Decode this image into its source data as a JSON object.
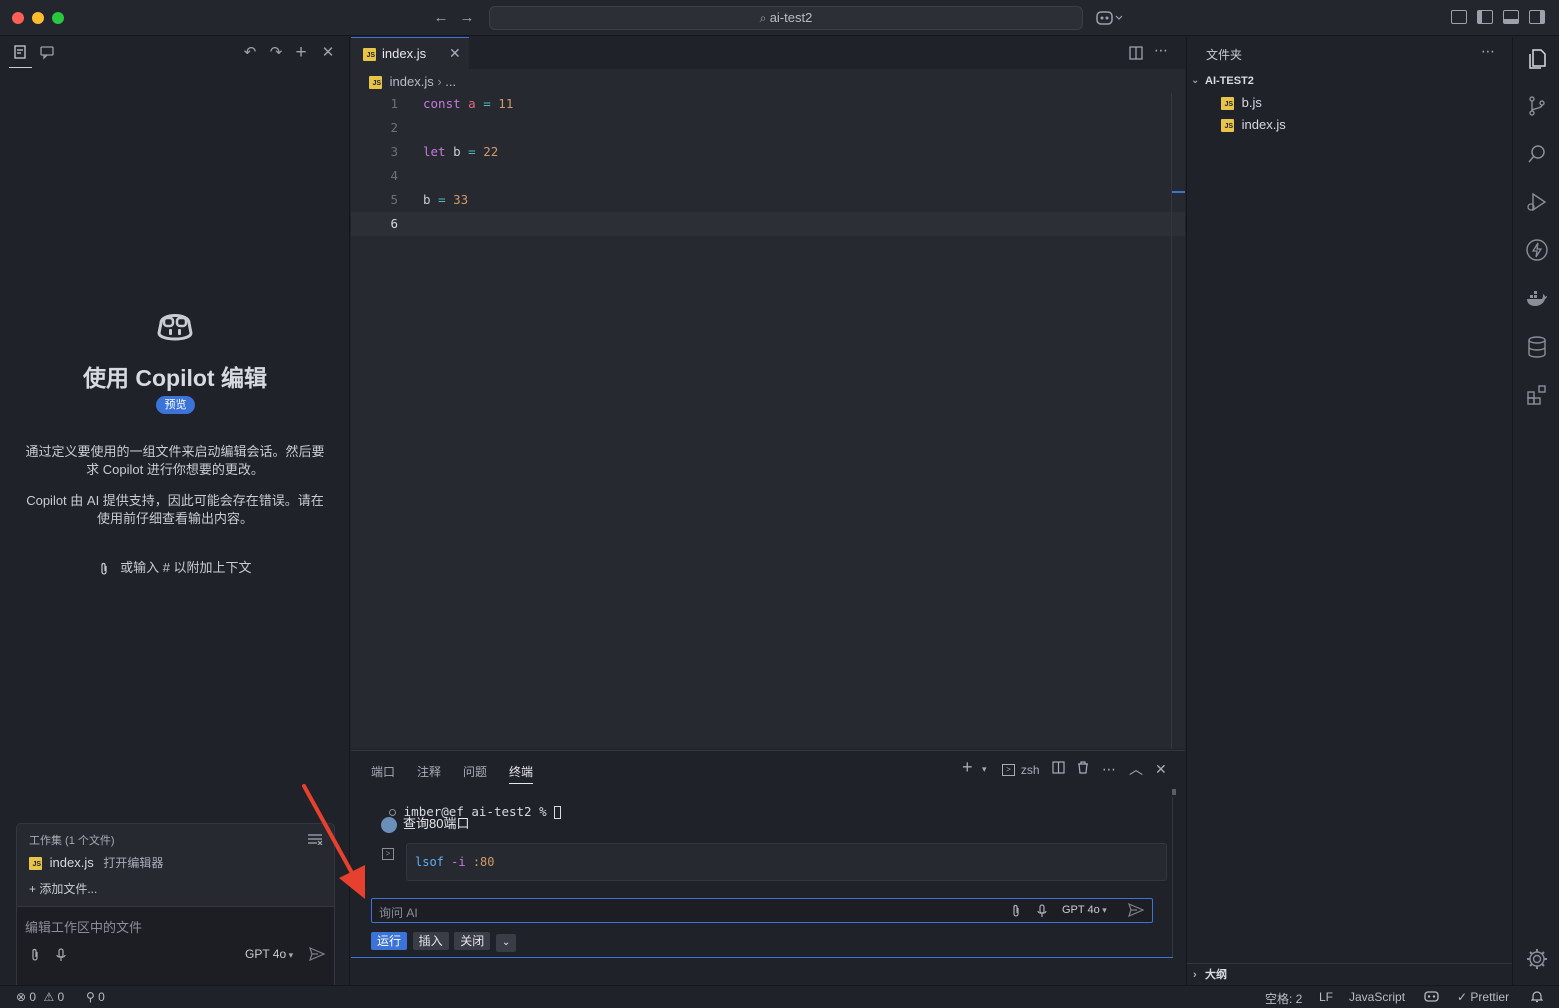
{
  "window": {
    "search_text": "ai-test2"
  },
  "left_panel": {
    "title": "使用 Copilot 编辑",
    "badge": "预览",
    "description_1": "通过定义要使用的一组文件来启动编辑会话。然后要求 Copilot 进行你想要的更改。",
    "description_2": "Copilot 由 AI 提供支持，因此可能会存在错误。请在使用前仔细查看输出内容。",
    "attach_hint": "或输入 # 以附加上下文",
    "workset": {
      "title": "工作集 (1 个文件)",
      "file": "index.js",
      "file_action": "打开编辑器",
      "add_files": "添加文件..."
    },
    "chat_input_placeholder": "编辑工作区中的文件",
    "model": "GPT 4o"
  },
  "editor": {
    "tab_label": "index.js",
    "breadcrumb_file": "index.js",
    "breadcrumb_more": "...",
    "lines": [
      {
        "n": "1",
        "code": "const a = 11"
      },
      {
        "n": "2",
        "code": ""
      },
      {
        "n": "3",
        "code": "let b = 22"
      },
      {
        "n": "4",
        "code": ""
      },
      {
        "n": "5",
        "code": "b = 33"
      },
      {
        "n": "6",
        "code": ""
      }
    ]
  },
  "panel": {
    "tabs": [
      "端口",
      "注释",
      "问题",
      "终端"
    ],
    "active_tab": "终端",
    "shell": "zsh",
    "prompt": "imber@ef ai-test2 % ",
    "ai_query": "查询80端口",
    "command_name": "lsof",
    "command_flag": "-i",
    "command_arg": ":80",
    "ask_placeholder": "询问 AI",
    "model": "GPT 4o",
    "buttons": {
      "run": "运行",
      "insert": "插入",
      "close": "关闭"
    }
  },
  "explorer": {
    "header": "文件夹",
    "root": "AI-TEST2",
    "files": [
      "b.js",
      "index.js"
    ],
    "outline": "大纲"
  },
  "status_bar": {
    "errors": "0",
    "warnings": "0",
    "ports": "0",
    "spaces": "空格: 2",
    "eol": "LF",
    "language": "JavaScript",
    "formatter": "Prettier"
  },
  "colors": {
    "accent": "#3b73d9",
    "js_badge": "#e8c549",
    "keyword": "#c678dd",
    "variable": "#e06c75",
    "number": "#d19a66"
  }
}
